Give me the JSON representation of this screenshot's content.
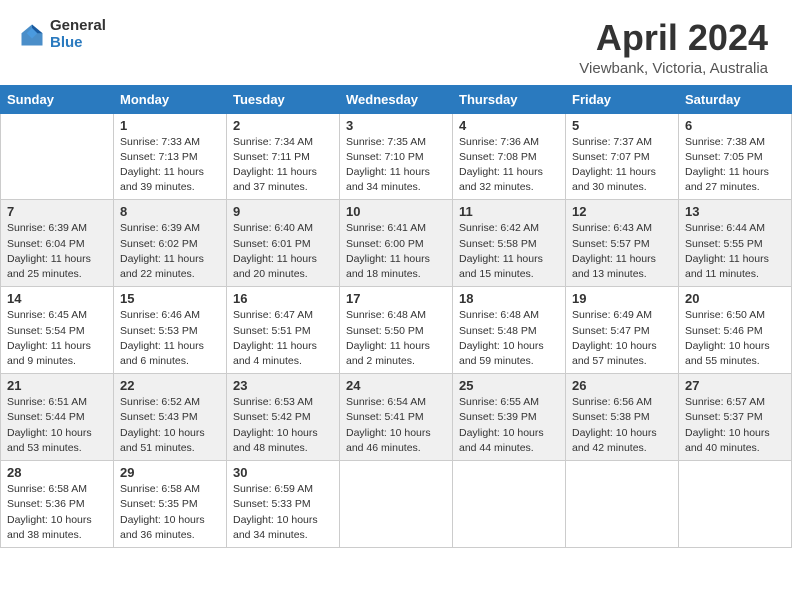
{
  "header": {
    "logo_general": "General",
    "logo_blue": "Blue",
    "month_title": "April 2024",
    "subtitle": "Viewbank, Victoria, Australia"
  },
  "days_of_week": [
    "Sunday",
    "Monday",
    "Tuesday",
    "Wednesday",
    "Thursday",
    "Friday",
    "Saturday"
  ],
  "weeks": [
    [
      {
        "day": "",
        "info": ""
      },
      {
        "day": "1",
        "info": "Sunrise: 7:33 AM\nSunset: 7:13 PM\nDaylight: 11 hours\nand 39 minutes."
      },
      {
        "day": "2",
        "info": "Sunrise: 7:34 AM\nSunset: 7:11 PM\nDaylight: 11 hours\nand 37 minutes."
      },
      {
        "day": "3",
        "info": "Sunrise: 7:35 AM\nSunset: 7:10 PM\nDaylight: 11 hours\nand 34 minutes."
      },
      {
        "day": "4",
        "info": "Sunrise: 7:36 AM\nSunset: 7:08 PM\nDaylight: 11 hours\nand 32 minutes."
      },
      {
        "day": "5",
        "info": "Sunrise: 7:37 AM\nSunset: 7:07 PM\nDaylight: 11 hours\nand 30 minutes."
      },
      {
        "day": "6",
        "info": "Sunrise: 7:38 AM\nSunset: 7:05 PM\nDaylight: 11 hours\nand 27 minutes."
      }
    ],
    [
      {
        "day": "7",
        "info": "Sunrise: 6:39 AM\nSunset: 6:04 PM\nDaylight: 11 hours\nand 25 minutes."
      },
      {
        "day": "8",
        "info": "Sunrise: 6:39 AM\nSunset: 6:02 PM\nDaylight: 11 hours\nand 22 minutes."
      },
      {
        "day": "9",
        "info": "Sunrise: 6:40 AM\nSunset: 6:01 PM\nDaylight: 11 hours\nand 20 minutes."
      },
      {
        "day": "10",
        "info": "Sunrise: 6:41 AM\nSunset: 6:00 PM\nDaylight: 11 hours\nand 18 minutes."
      },
      {
        "day": "11",
        "info": "Sunrise: 6:42 AM\nSunset: 5:58 PM\nDaylight: 11 hours\nand 15 minutes."
      },
      {
        "day": "12",
        "info": "Sunrise: 6:43 AM\nSunset: 5:57 PM\nDaylight: 11 hours\nand 13 minutes."
      },
      {
        "day": "13",
        "info": "Sunrise: 6:44 AM\nSunset: 5:55 PM\nDaylight: 11 hours\nand 11 minutes."
      }
    ],
    [
      {
        "day": "14",
        "info": "Sunrise: 6:45 AM\nSunset: 5:54 PM\nDaylight: 11 hours\nand 9 minutes."
      },
      {
        "day": "15",
        "info": "Sunrise: 6:46 AM\nSunset: 5:53 PM\nDaylight: 11 hours\nand 6 minutes."
      },
      {
        "day": "16",
        "info": "Sunrise: 6:47 AM\nSunset: 5:51 PM\nDaylight: 11 hours\nand 4 minutes."
      },
      {
        "day": "17",
        "info": "Sunrise: 6:48 AM\nSunset: 5:50 PM\nDaylight: 11 hours\nand 2 minutes."
      },
      {
        "day": "18",
        "info": "Sunrise: 6:48 AM\nSunset: 5:48 PM\nDaylight: 10 hours\nand 59 minutes."
      },
      {
        "day": "19",
        "info": "Sunrise: 6:49 AM\nSunset: 5:47 PM\nDaylight: 10 hours\nand 57 minutes."
      },
      {
        "day": "20",
        "info": "Sunrise: 6:50 AM\nSunset: 5:46 PM\nDaylight: 10 hours\nand 55 minutes."
      }
    ],
    [
      {
        "day": "21",
        "info": "Sunrise: 6:51 AM\nSunset: 5:44 PM\nDaylight: 10 hours\nand 53 minutes."
      },
      {
        "day": "22",
        "info": "Sunrise: 6:52 AM\nSunset: 5:43 PM\nDaylight: 10 hours\nand 51 minutes."
      },
      {
        "day": "23",
        "info": "Sunrise: 6:53 AM\nSunset: 5:42 PM\nDaylight: 10 hours\nand 48 minutes."
      },
      {
        "day": "24",
        "info": "Sunrise: 6:54 AM\nSunset: 5:41 PM\nDaylight: 10 hours\nand 46 minutes."
      },
      {
        "day": "25",
        "info": "Sunrise: 6:55 AM\nSunset: 5:39 PM\nDaylight: 10 hours\nand 44 minutes."
      },
      {
        "day": "26",
        "info": "Sunrise: 6:56 AM\nSunset: 5:38 PM\nDaylight: 10 hours\nand 42 minutes."
      },
      {
        "day": "27",
        "info": "Sunrise: 6:57 AM\nSunset: 5:37 PM\nDaylight: 10 hours\nand 40 minutes."
      }
    ],
    [
      {
        "day": "28",
        "info": "Sunrise: 6:58 AM\nSunset: 5:36 PM\nDaylight: 10 hours\nand 38 minutes."
      },
      {
        "day": "29",
        "info": "Sunrise: 6:58 AM\nSunset: 5:35 PM\nDaylight: 10 hours\nand 36 minutes."
      },
      {
        "day": "30",
        "info": "Sunrise: 6:59 AM\nSunset: 5:33 PM\nDaylight: 10 hours\nand 34 minutes."
      },
      {
        "day": "",
        "info": ""
      },
      {
        "day": "",
        "info": ""
      },
      {
        "day": "",
        "info": ""
      },
      {
        "day": "",
        "info": ""
      }
    ]
  ]
}
